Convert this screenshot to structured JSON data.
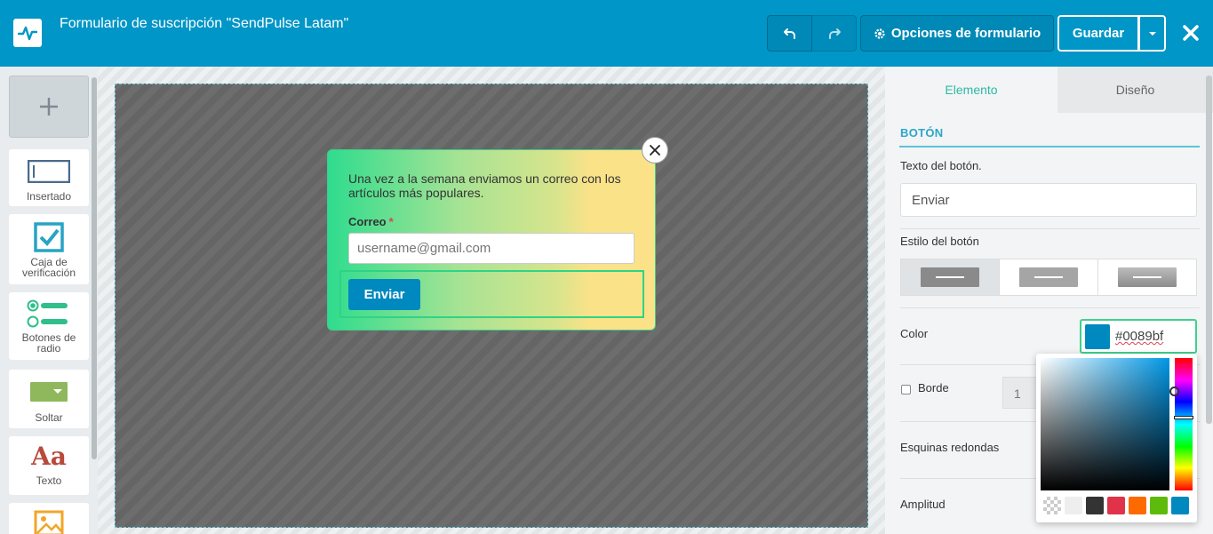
{
  "header": {
    "title": "Formulario de suscripción \"SendPulse Latam\"",
    "options_label": "Opciones de formulario",
    "save_label": "Guardar"
  },
  "tools": {
    "items": [
      {
        "label": "Insertado",
        "icon": "embedded-icon"
      },
      {
        "label": "Caja de verificación",
        "icon": "checkbox-icon"
      },
      {
        "label": "Botones de radio",
        "icon": "radio-icon"
      },
      {
        "label": "Soltar",
        "icon": "dropdown-icon"
      },
      {
        "label": "Texto",
        "icon": "text-icon",
        "glyph": "Aa"
      },
      {
        "label": "",
        "icon": "image-icon"
      }
    ]
  },
  "form": {
    "description": "Una vez a la semana enviamos un correo con los artículos más populares.",
    "email_label": "Correo",
    "required_mark": "*",
    "email_placeholder": "username@gmail.com",
    "submit_label": "Enviar",
    "colors": {
      "button": "#0089bf",
      "gradient_start": "#2fdc8e",
      "gradient_end": "#fbe288"
    }
  },
  "panel": {
    "tabs": [
      {
        "label": "Elemento",
        "active": true
      },
      {
        "label": "Diseño",
        "active": false
      }
    ],
    "section_title": "BOTÓN",
    "button_text_label": "Texto del botón.",
    "button_text_value": "Enviar",
    "button_style_label": "Estilo del botón",
    "color_label": "Color",
    "color_value": "#0089bf",
    "border_label": "Borde",
    "border_value": "1",
    "rounded_label": "Esquinas redondas",
    "width_label": "Amplitud"
  },
  "picker": {
    "presets": [
      "transparent",
      "#eeeeee",
      "#333333",
      "#e0334a",
      "#ff6a00",
      "#5dbb0b",
      "#0089bf"
    ]
  }
}
